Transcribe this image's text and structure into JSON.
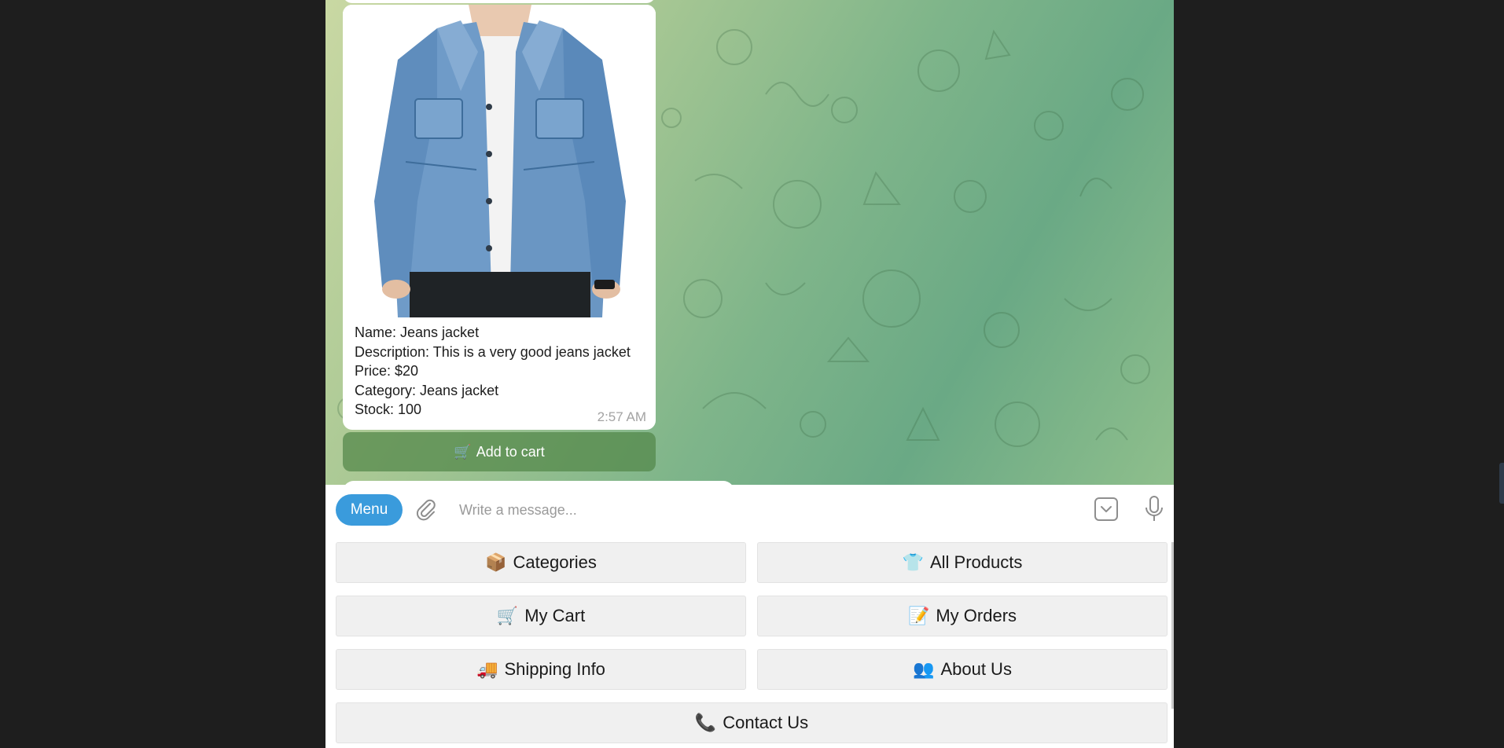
{
  "chat": {
    "product_card": {
      "image_alt": "Jeans jacket",
      "lines": [
        "Name: Jeans jacket",
        "Description: This is a very good jeans jacket",
        "Price: $20",
        "Category: Jeans jacket",
        "Stock: 100"
      ],
      "time": "2:57 AM"
    },
    "inline_button": {
      "icon": "🛒",
      "label": "Add to cart"
    }
  },
  "composer": {
    "menu_label": "Menu",
    "placeholder": "Write a message...",
    "icons": [
      "paperclip-icon",
      "bot-keyboard-icon",
      "microphone-icon"
    ]
  },
  "reply_keyboard": {
    "buttons": [
      {
        "emoji": "📦",
        "label": "Categories"
      },
      {
        "emoji": "👕",
        "label": "All Products"
      },
      {
        "emoji": "🛒",
        "label": "My Cart"
      },
      {
        "emoji": "📝",
        "label": "My Orders"
      },
      {
        "emoji": "🚚",
        "label": "Shipping Info"
      },
      {
        "emoji": "👥",
        "label": "About Us"
      },
      {
        "emoji": "📞",
        "label": "Contact Us"
      }
    ]
  },
  "colors": {
    "accent": "#3a9bdc",
    "inline_button_bg": "#528748",
    "keyboard_button_bg": "#f0f0f0",
    "page_bg": "#1e1e1e"
  }
}
